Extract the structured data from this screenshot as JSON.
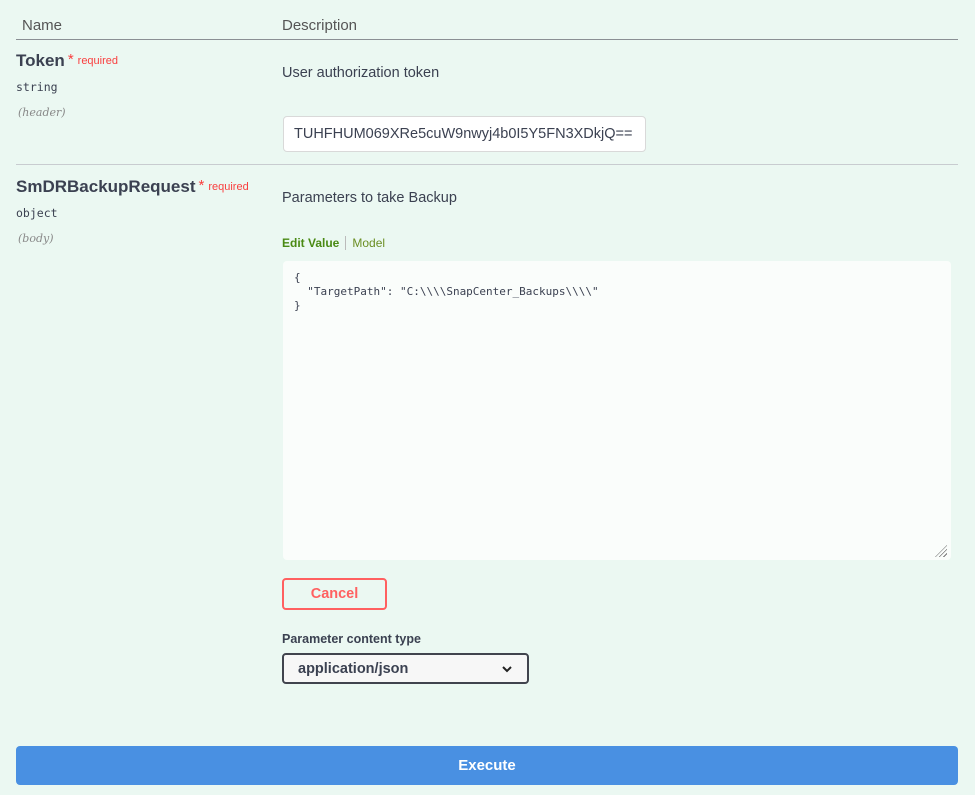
{
  "headers": {
    "name": "Name",
    "description": "Description"
  },
  "params": [
    {
      "name": "Token",
      "required_star": "*",
      "required": "required",
      "type": "string",
      "location": "(header)",
      "description": "User authorization token",
      "value": "TUHFHUM069XRe5cuW9nwyj4b0I5Y5FN3XDkjQ=="
    },
    {
      "name": "SmDRBackupRequest",
      "required_star": "*",
      "required": "required",
      "type": "object",
      "location": "(body)",
      "description": "Parameters to take Backup",
      "tabs": {
        "edit": "Edit Value",
        "model": "Model"
      },
      "body": "{\n  \"TargetPath\": \"C:\\\\\\\\SnapCenter_Backups\\\\\\\\\"\n}",
      "cancel": "Cancel",
      "content_type_label": "Parameter content type",
      "content_type": "application/json"
    }
  ],
  "execute": "Execute"
}
